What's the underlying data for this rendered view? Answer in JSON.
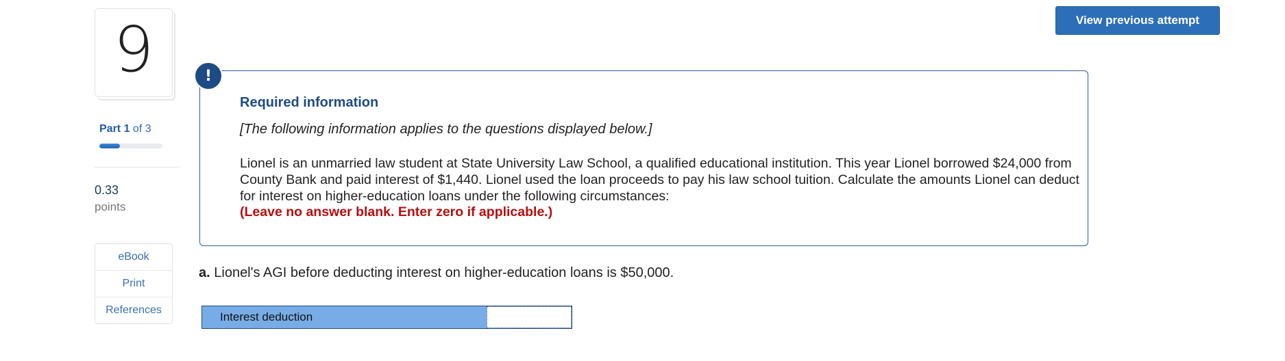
{
  "question": {
    "number": "9",
    "part_current": "Part 1",
    "part_total": "of 3",
    "part_progress": 0.33,
    "points_value": "0.33",
    "points_label": "points"
  },
  "tools": [
    {
      "label": "eBook"
    },
    {
      "label": "Print"
    },
    {
      "label": "References"
    }
  ],
  "header": {
    "view_previous_attempt": "View previous attempt"
  },
  "info": {
    "icon": "!",
    "title": "Required information",
    "italic_note": "[The following information applies to the questions displayed below.]",
    "body": "Lionel is an unmarried law student at State University Law School, a qualified educational institution. This year Lionel borrowed $24,000 from County Bank and paid interest of $1,440. Lionel used the loan proceeds to pay his law school tuition. Calculate the amounts Lionel can deduct for interest on higher-education loans under the following circumstances:",
    "warning": "(Leave no answer blank. Enter zero if applicable.)"
  },
  "part_a": {
    "letter": "a.",
    "text": "Lionel's AGI before deducting interest on higher-education loans is $50,000.",
    "row_label": "Interest deduction",
    "input_value": ""
  },
  "colors": {
    "brand_blue": "#1d4b85",
    "button_blue": "#2c6fb8",
    "warning_red": "#b80d0d",
    "label_fill": "#78ace6"
  }
}
